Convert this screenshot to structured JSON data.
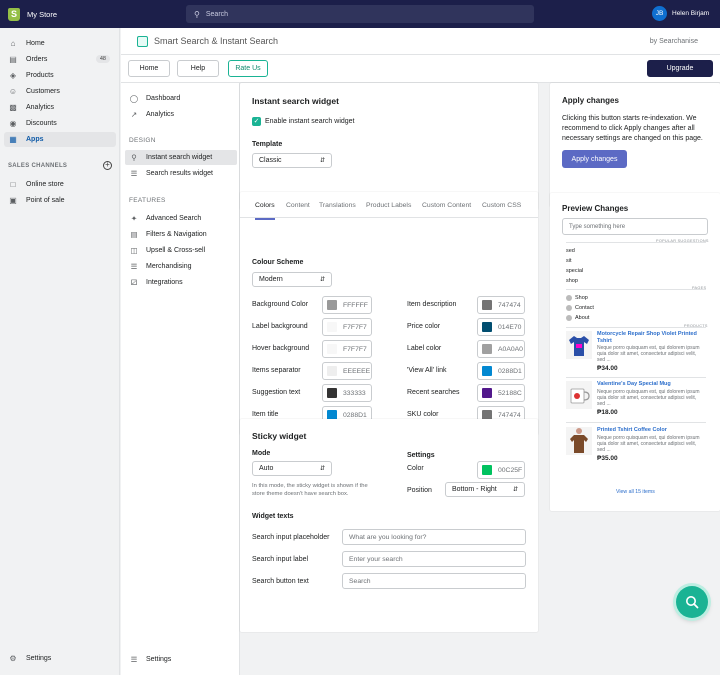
{
  "topbar": {
    "store_name": "My Store",
    "search_placeholder": "Search",
    "user_initials": "JB",
    "user_name": "Helen Birjam"
  },
  "nav": {
    "items": [
      {
        "label": "Home",
        "icon": "home-icon"
      },
      {
        "label": "Orders",
        "icon": "orders-icon",
        "badge": "48"
      },
      {
        "label": "Products",
        "icon": "tag-icon"
      },
      {
        "label": "Customers",
        "icon": "person-icon"
      },
      {
        "label": "Analytics",
        "icon": "analytics-icon"
      },
      {
        "label": "Discounts",
        "icon": "discount-icon"
      },
      {
        "label": "Apps",
        "icon": "apps-icon"
      }
    ],
    "sales_channels_heading": "SALES CHANNELS",
    "channels": [
      {
        "label": "Online store"
      },
      {
        "label": "Point of sale"
      }
    ],
    "settings_label": "Settings"
  },
  "app": {
    "title": "Smart Search & Instant Search",
    "byline": "by Searchanise",
    "toolbar": {
      "home": "Home",
      "help": "Help",
      "rate": "Rate Us",
      "upgrade": "Upgrade"
    }
  },
  "subnav": {
    "items": [
      {
        "label": "Dashboard"
      },
      {
        "label": "Analytics"
      }
    ],
    "design_heading": "DESIGN",
    "design_items": [
      {
        "label": "Instant search widget"
      },
      {
        "label": "Search results widget"
      }
    ],
    "features_heading": "FEATURES",
    "feature_items": [
      {
        "label": "Advanced Search"
      },
      {
        "label": "Filters & Navigation"
      },
      {
        "label": "Upsell & Cross-sell"
      },
      {
        "label": "Merchandising"
      },
      {
        "label": "Integrations"
      }
    ],
    "settings_label": "Settings"
  },
  "instant_widget": {
    "title": "Instant search widget",
    "enable_label": "Enable instant search widget",
    "template_label": "Template",
    "template_value": "Classic"
  },
  "colors_card": {
    "tabs": [
      "Colors",
      "Content",
      "Translations",
      "Product Labels",
      "Custom Content",
      "Custom CSS"
    ],
    "scheme_label": "Colour Scheme",
    "scheme_value": "Modern",
    "left": [
      {
        "label": "Background Color",
        "value": "FFFFFF",
        "color": "#999999"
      },
      {
        "label": "Label background",
        "value": "F7F7F7",
        "color": "#F7F7F7"
      },
      {
        "label": "Hover background",
        "value": "F7F7F7",
        "color": "#F7F7F7"
      },
      {
        "label": "Items separator",
        "value": "EEEEEE",
        "color": "#EEEEEE"
      },
      {
        "label": "Suggestion text",
        "value": "333333",
        "color": "#333333"
      },
      {
        "label": "Item title",
        "value": "0288D1",
        "color": "#0288D1"
      }
    ],
    "right": [
      {
        "label": "Item description",
        "value": "747474",
        "color": "#747474"
      },
      {
        "label": "Price color",
        "value": "014E70",
        "color": "#014E70"
      },
      {
        "label": "Label color",
        "value": "A0A0A0",
        "color": "#A0A0A0"
      },
      {
        "label": "'View All' link",
        "value": "0288D1",
        "color": "#0288D1"
      },
      {
        "label": "Recent searches",
        "value": "52188C",
        "color": "#52188C"
      },
      {
        "label": "SKU color",
        "value": "747474",
        "color": "#747474"
      }
    ]
  },
  "sticky": {
    "title": "Sticky widget",
    "mode_label": "Mode",
    "mode_value": "Auto",
    "hint": "In this mode, the sticky widget is shown if the store theme doesn't have search box.",
    "settings_label": "Settings",
    "color_label": "Color",
    "color_value": "00C25F",
    "color_hex": "#00C25F",
    "position_label": "Position",
    "position_value": "Bottom - Right",
    "widget_texts_label": "Widget texts",
    "fields": [
      {
        "label": "Search input placeholder",
        "value": "What are you looking for?"
      },
      {
        "label": "Search input label",
        "value": "Enter your search"
      },
      {
        "label": "Search button text",
        "value": "Search"
      }
    ]
  },
  "apply": {
    "title": "Apply changes",
    "text": "Clicking this button starts re-indexation. We recommend to click Apply changes after all necessary settings are changed on this page.",
    "button": "Apply changes"
  },
  "preview": {
    "title": "Preview Changes",
    "placeholder": "Type something here",
    "suggestions_label": "POPULAR SUGGESTIONS",
    "suggestions": [
      "sed",
      "sit",
      "special",
      "shop"
    ],
    "pages_label": "PAGES",
    "pages": [
      "Shop",
      "Contact",
      "About"
    ],
    "products_label": "PRODUCTS",
    "products": [
      {
        "name": "Motorcycle Repair Shop Violet Printed Tshirt",
        "desc": "Neque porro quisquam est, qui dolorem ipsum quia dolor sit amet, consectetur adipisci velit, sed ...",
        "price": "₱34.00"
      },
      {
        "name": "Valentine's Day Special Mug",
        "desc": "Neque porro quisquam est, qui dolorem ipsum quia dolor sit amet, consectetur adipisci velit, sed ...",
        "price": "₱18.00"
      },
      {
        "name": "Printed Tshirt Coffee Color",
        "desc": "Neque porro quisquam est, qui dolorem ipsum quia dolor sit amet, consectetur adipisci velit, sed ...",
        "price": "₱35.00"
      }
    ],
    "view_all": "View all 15 items"
  }
}
